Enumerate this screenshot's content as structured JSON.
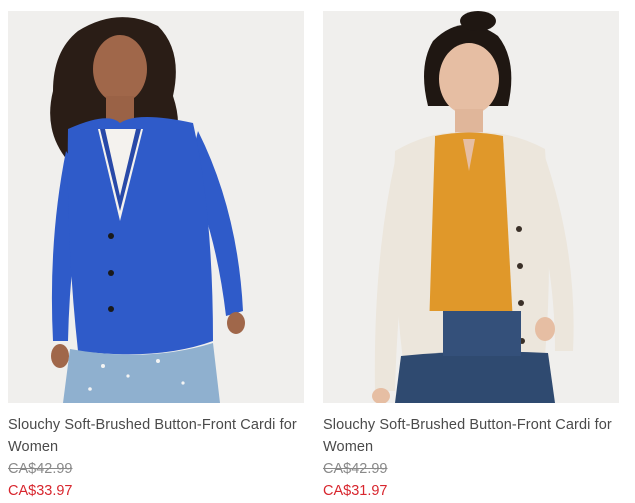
{
  "products": [
    {
      "name": "Slouchy Soft-Brushed Button-Front Cardi for Women",
      "price_original": "CA$42.99",
      "price_sale": "CA$33.97",
      "image_alt": "Woman wearing a blue cardigan with jeans",
      "colors": {
        "cardigan": "#2f5bc9",
        "background": "#f0efed"
      }
    },
    {
      "name": "Slouchy Soft-Brushed Button-Front Cardi for Women",
      "price_original": "CA$42.99",
      "price_sale": "CA$31.97",
      "image_alt": "Woman wearing a cream cardigan over a mustard blouse with jeans",
      "colors": {
        "cardigan": "#ece6dc",
        "top": "#e0982a",
        "background": "#f0efed"
      }
    }
  ],
  "colors": {
    "text": "#4a4a4a",
    "strikethrough": "#8a8a8a",
    "sale": "#d8262e"
  }
}
